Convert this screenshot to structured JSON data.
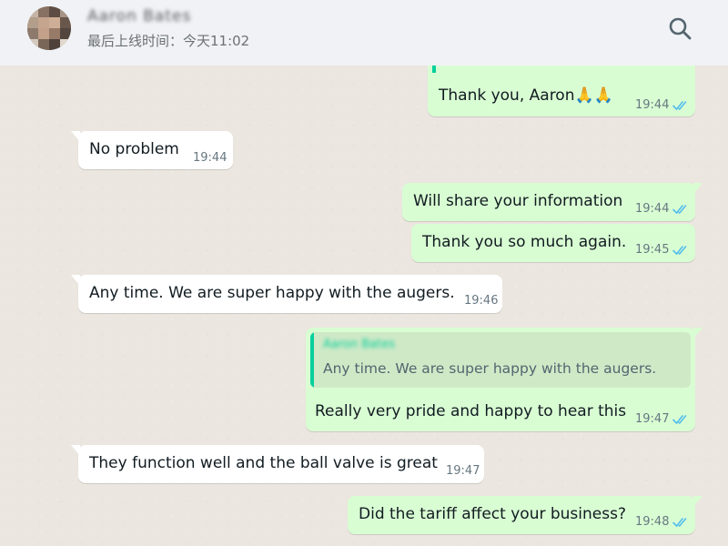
{
  "header": {
    "contact_name": "Aaron Bates",
    "last_seen": "最后上线时间：今天11:02",
    "search_icon": "search-icon"
  },
  "messages": [
    {
      "direction": "out",
      "text": "Thank you, Aaron🙏🙏",
      "time": "19:44",
      "status": "read"
    },
    {
      "direction": "in",
      "text": "No problem",
      "time": "19:44"
    },
    {
      "direction": "out",
      "text": "Will share your information",
      "time": "19:44",
      "status": "read"
    },
    {
      "direction": "out",
      "text": "Thank you so much again.",
      "time": "19:45",
      "status": "read"
    },
    {
      "direction": "in",
      "text": "Any time. We are super happy with the augers.",
      "time": "19:46"
    },
    {
      "direction": "out",
      "quote_name": "Aaron Bates",
      "quote_text": "Any time. We are super happy with the augers.",
      "text": "Really very pride and happy to hear this",
      "time": "19:47",
      "status": "read"
    },
    {
      "direction": "in",
      "text": "They function well and the ball valve is great",
      "time": "19:47"
    },
    {
      "direction": "out",
      "text": "Did the tariff affect your business?",
      "time": "19:48",
      "status": "read"
    }
  ],
  "colors": {
    "header_bg": "#f0f2f5",
    "incoming_bubble": "#ffffff",
    "outgoing_bubble": "#d9fdd3",
    "read_ticks": "#53bdeb",
    "quote_accent": "#06cf9c"
  }
}
